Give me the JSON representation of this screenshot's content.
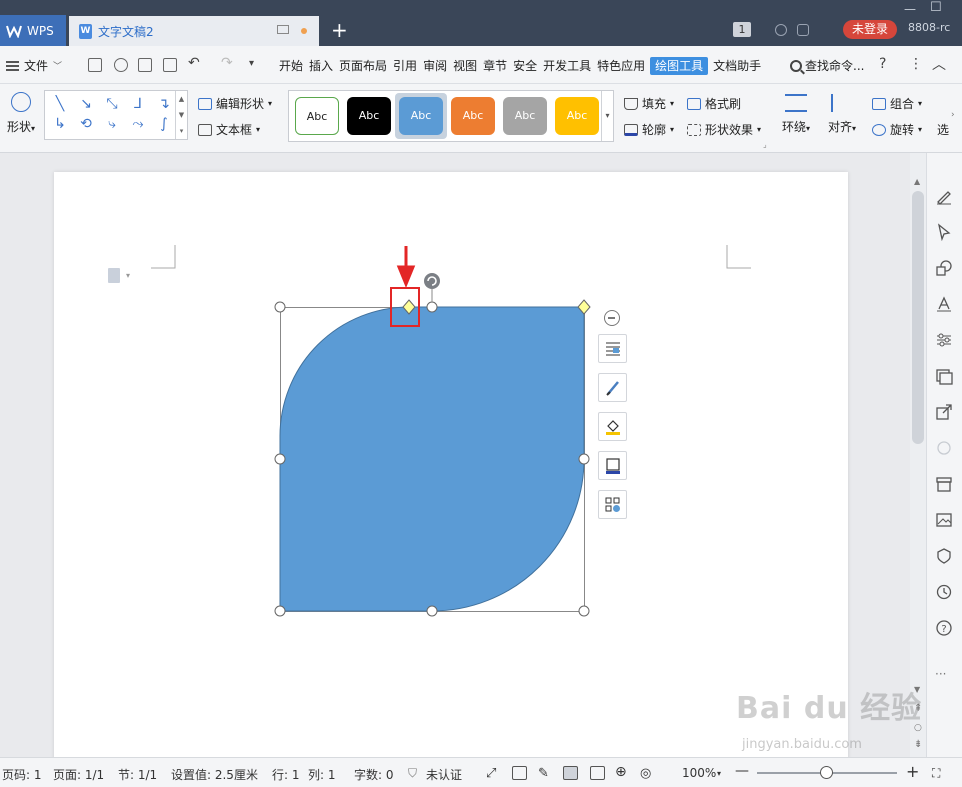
{
  "titlebar": {
    "app_tab": "WPS",
    "doc_tab": "文字文稿2",
    "page_count_badge": "1",
    "login_button": "未登录",
    "user_id": "8808-rc"
  },
  "menubar": {
    "file": "文件",
    "items": [
      "开始",
      "插入",
      "页面布局",
      "引用",
      "审阅",
      "视图",
      "章节",
      "安全",
      "开发工具",
      "特色应用",
      "绘图工具",
      "文档助手"
    ],
    "active_item": "绘图工具",
    "search": "查找命令...",
    "help": "?"
  },
  "ribbon": {
    "shape": "形状",
    "edit_shape": "编辑形状",
    "textbox": "文本框",
    "styles": [
      {
        "label": "Abc",
        "bg": "#ffffff",
        "fg": "#222222",
        "border": "#5aa84c"
      },
      {
        "label": "Abc",
        "bg": "#000000",
        "fg": "#ffffff",
        "border": "#000000"
      },
      {
        "label": "Abc",
        "bg": "#5b9bd5",
        "fg": "#ffffff",
        "border": "#5b9bd5"
      },
      {
        "label": "Abc",
        "bg": "#ed7d31",
        "fg": "#ffffff",
        "border": "#ed7d31"
      },
      {
        "label": "Abc",
        "bg": "#a5a5a5",
        "fg": "#ffffff",
        "border": "#a5a5a5"
      },
      {
        "label": "Abc",
        "bg": "#ffc000",
        "fg": "#ffffff",
        "border": "#ffc000"
      }
    ],
    "selected_style_index": 2,
    "fill": "填充",
    "outline": "轮廓",
    "format_painter": "格式刷",
    "shape_effects": "形状效果",
    "wrap": "环绕",
    "align": "对齐",
    "group": "组合",
    "rotate": "旋转",
    "more": "选"
  },
  "shape": {
    "fill_color": "#5b9bd5",
    "outline_color": "#41719c",
    "handle_color": "#ffff99",
    "annotation_color": "#e32626"
  },
  "statusbar": {
    "page_no": "页码: 1",
    "pages": "页面: 1/1",
    "section": "节: 1/1",
    "setting": "设置值: 2.5厘米",
    "row": "行: 1",
    "col": "列: 1",
    "word_count": "字数: 0",
    "auth": "未认证",
    "zoom": "100%"
  },
  "watermark": {
    "brand": "Bai du 经验",
    "url": "jingyan.baidu.com"
  }
}
